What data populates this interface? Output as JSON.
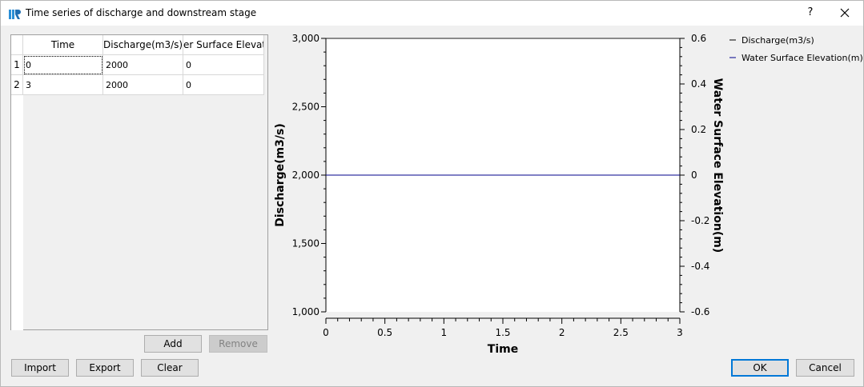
{
  "window": {
    "title": "Time series of discharge and downstream stage",
    "help_label": "?"
  },
  "table": {
    "columns": [
      "Time",
      "Discharge(m3/s)",
      "er Surface Elevatio"
    ],
    "rows": [
      {
        "num": "1",
        "cells": [
          "0",
          "2000",
          "0"
        ]
      },
      {
        "num": "2",
        "cells": [
          "3",
          "2000",
          "0"
        ]
      }
    ]
  },
  "buttons": {
    "add": "Add",
    "remove": "Remove",
    "import": "Import",
    "export": "Export",
    "clear": "Clear",
    "ok": "OK",
    "cancel": "Cancel"
  },
  "colors": {
    "discharge": "#000000",
    "water_surface": "#00008b"
  },
  "chart_data": {
    "type": "line",
    "xlabel": "Time",
    "ylabel": "Discharge(m3/s)",
    "y2label": "Water Surface Elevation(m)",
    "xlim": [
      0,
      3
    ],
    "ylim": [
      1000,
      3000
    ],
    "y2lim": [
      -0.6,
      0.6
    ],
    "x_ticks": [
      "0",
      "0.5",
      "1",
      "1.5",
      "2",
      "2.5",
      "3"
    ],
    "y_ticks": [
      "1,000",
      "1,500",
      "2,000",
      "2,500",
      "3,000"
    ],
    "y2_ticks": [
      "-0.6",
      "-0.4",
      "-0.2",
      "0",
      "0.2",
      "0.4",
      "0.6"
    ],
    "legend_position": "top-right",
    "series": [
      {
        "name": "Discharge(m3/s)",
        "axis": "left",
        "x": [
          0,
          3
        ],
        "values": [
          2000,
          2000
        ]
      },
      {
        "name": "Water Surface Elevation(m)",
        "axis": "right",
        "x": [
          0,
          3
        ],
        "values": [
          0,
          0
        ]
      }
    ]
  }
}
